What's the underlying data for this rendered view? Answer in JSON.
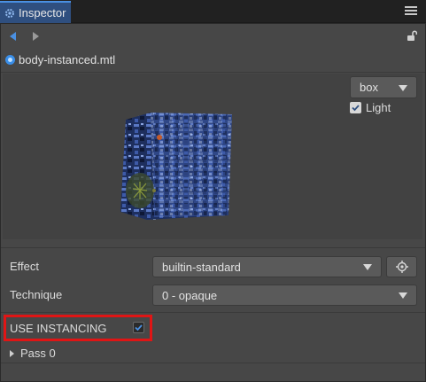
{
  "tab": {
    "title": "Inspector",
    "icon": "gear-icon"
  },
  "toolbar": {
    "back": "arrow-left-icon",
    "forward": "arrow-right-icon",
    "lock": "unlock-icon"
  },
  "asset": {
    "name": "body-instanced.mtl",
    "icon": "material-icon"
  },
  "preview": {
    "mesh_value": "box",
    "light_label": "Light",
    "light_checked": true
  },
  "properties": {
    "effect_label": "Effect",
    "effect_value": "builtin-standard",
    "technique_label": "Technique",
    "technique_value": "0 - opaque",
    "instancing_label": "USE  INSTANCING",
    "instancing_checked": true,
    "pass_label": "Pass 0"
  },
  "colors": {
    "accent": "#4a90e2",
    "highlight": "#e01515",
    "panel": "#474747"
  }
}
